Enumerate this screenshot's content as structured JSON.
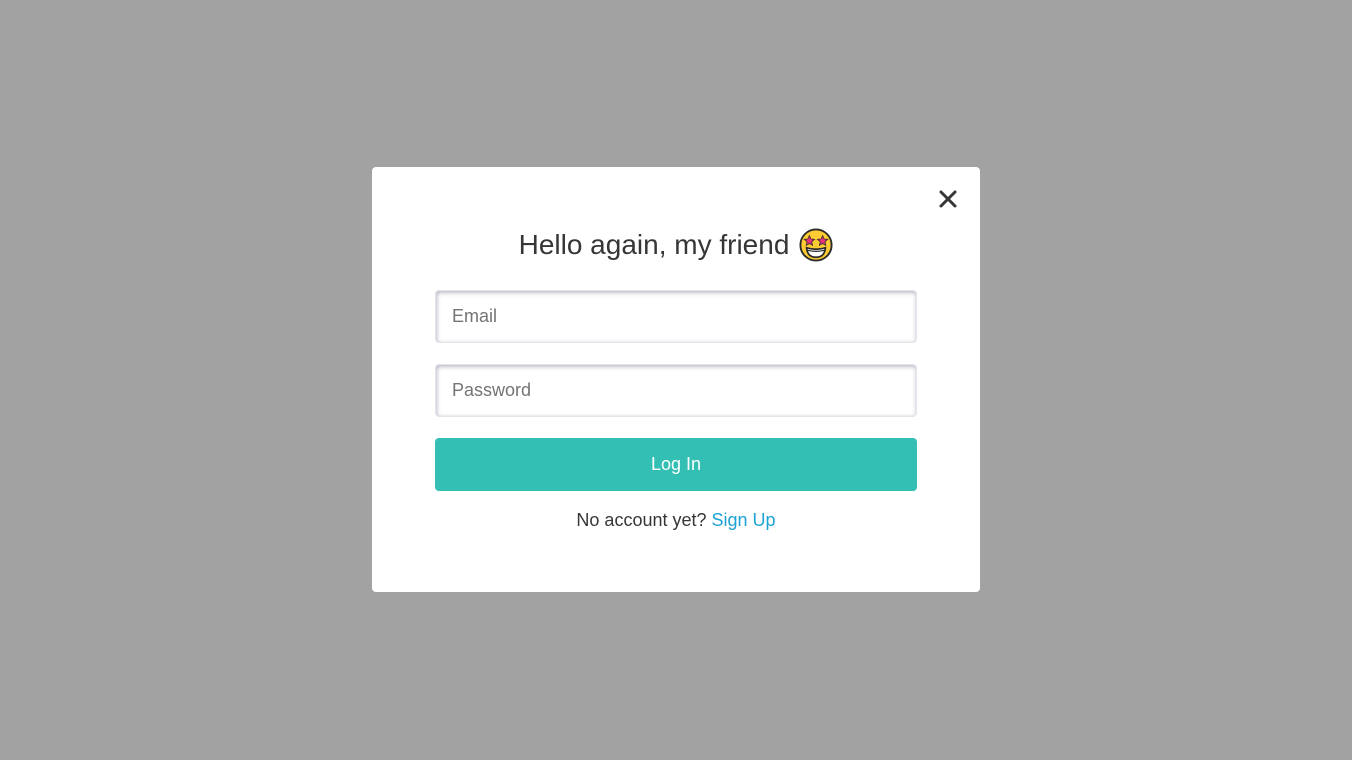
{
  "modal": {
    "title": "Hello again, my friend",
    "title_emoji": "star-struck-emoji-icon",
    "close_icon": "close-icon"
  },
  "form": {
    "email_placeholder": "Email",
    "email_value": "",
    "password_placeholder": "Password",
    "password_value": "",
    "login_label": "Log In"
  },
  "footer": {
    "prompt": "No account yet?",
    "signup_label": "Sign Up"
  },
  "colors": {
    "overlay": "#a2a2a2",
    "modal_bg": "#ffffff",
    "button_bg": "#33bfb4",
    "link": "#1ea3d6",
    "text": "#363636"
  }
}
